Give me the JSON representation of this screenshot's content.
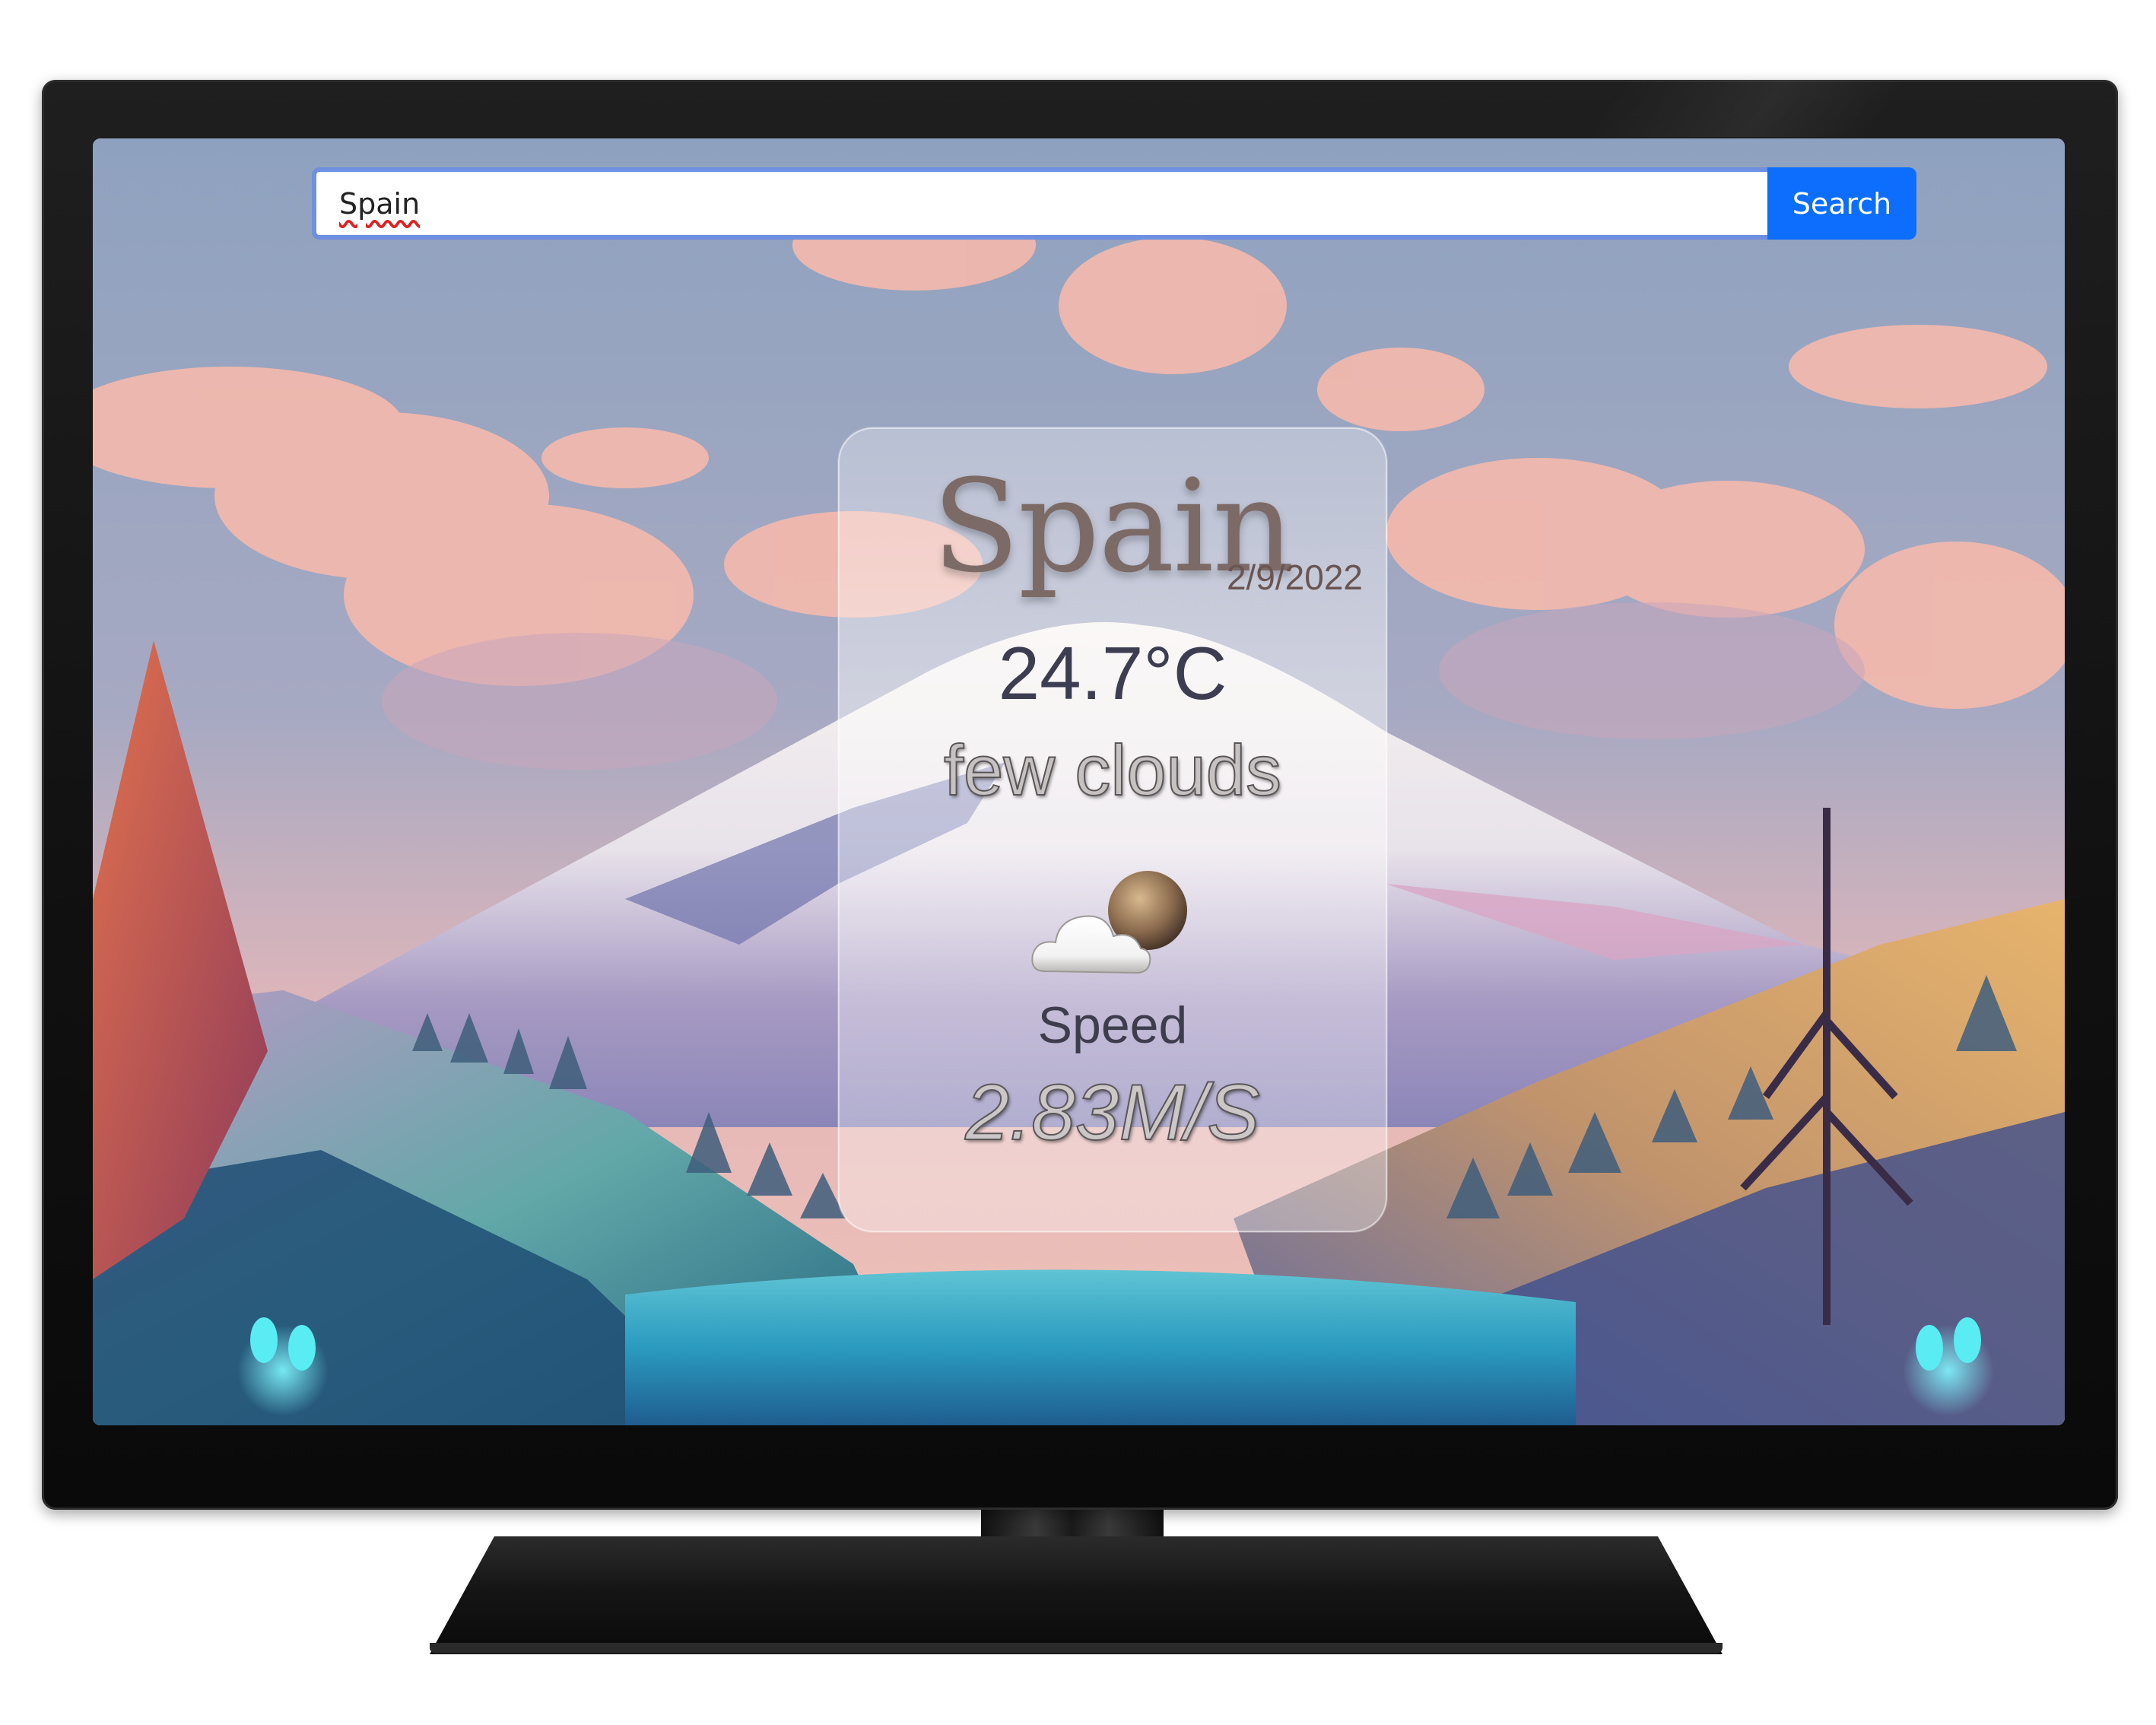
{
  "search": {
    "value": "Spain",
    "button_label": "Search"
  },
  "weather": {
    "city": "Spain",
    "date": "2/9/2022",
    "temperature": "24.7°C",
    "description": "few clouds",
    "speed_label": "Speed",
    "speed_value": "2.83M/S",
    "icon": "few-clouds-icon"
  },
  "colors": {
    "search_button": "#0d6efd",
    "search_border": "#6f8fe0",
    "sky": "#8fa3be",
    "cloud_pink": "#f3b2a8",
    "snow": "#f4f1ee",
    "lake": "#2aa8c4",
    "monitor": "#141414"
  }
}
